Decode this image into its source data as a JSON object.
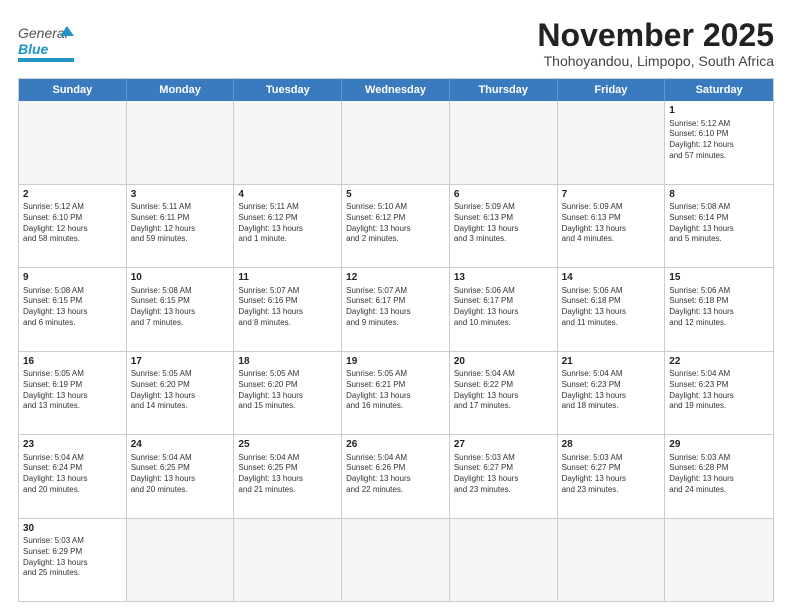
{
  "header": {
    "logo_general": "General",
    "logo_blue": "Blue",
    "title": "November 2025",
    "subtitle": "Thohoyandou, Limpopo, South Africa"
  },
  "days_of_week": [
    "Sunday",
    "Monday",
    "Tuesday",
    "Wednesday",
    "Thursday",
    "Friday",
    "Saturday"
  ],
  "weeks": [
    [
      {
        "date": "",
        "info": ""
      },
      {
        "date": "",
        "info": ""
      },
      {
        "date": "",
        "info": ""
      },
      {
        "date": "",
        "info": ""
      },
      {
        "date": "",
        "info": ""
      },
      {
        "date": "",
        "info": ""
      },
      {
        "date": "1",
        "info": "Sunrise: 5:12 AM\nSunset: 6:10 PM\nDaylight: 12 hours\nand 57 minutes."
      }
    ],
    [
      {
        "date": "2",
        "info": "Sunrise: 5:12 AM\nSunset: 6:10 PM\nDaylight: 12 hours\nand 58 minutes."
      },
      {
        "date": "3",
        "info": "Sunrise: 5:11 AM\nSunset: 6:11 PM\nDaylight: 12 hours\nand 59 minutes."
      },
      {
        "date": "4",
        "info": "Sunrise: 5:11 AM\nSunset: 6:12 PM\nDaylight: 13 hours\nand 1 minute."
      },
      {
        "date": "5",
        "info": "Sunrise: 5:10 AM\nSunset: 6:12 PM\nDaylight: 13 hours\nand 2 minutes."
      },
      {
        "date": "6",
        "info": "Sunrise: 5:09 AM\nSunset: 6:13 PM\nDaylight: 13 hours\nand 3 minutes."
      },
      {
        "date": "7",
        "info": "Sunrise: 5:09 AM\nSunset: 6:13 PM\nDaylight: 13 hours\nand 4 minutes."
      },
      {
        "date": "8",
        "info": "Sunrise: 5:08 AM\nSunset: 6:14 PM\nDaylight: 13 hours\nand 5 minutes."
      }
    ],
    [
      {
        "date": "9",
        "info": "Sunrise: 5:08 AM\nSunset: 6:15 PM\nDaylight: 13 hours\nand 6 minutes."
      },
      {
        "date": "10",
        "info": "Sunrise: 5:08 AM\nSunset: 6:15 PM\nDaylight: 13 hours\nand 7 minutes."
      },
      {
        "date": "11",
        "info": "Sunrise: 5:07 AM\nSunset: 6:16 PM\nDaylight: 13 hours\nand 8 minutes."
      },
      {
        "date": "12",
        "info": "Sunrise: 5:07 AM\nSunset: 6:17 PM\nDaylight: 13 hours\nand 9 minutes."
      },
      {
        "date": "13",
        "info": "Sunrise: 5:06 AM\nSunset: 6:17 PM\nDaylight: 13 hours\nand 10 minutes."
      },
      {
        "date": "14",
        "info": "Sunrise: 5:06 AM\nSunset: 6:18 PM\nDaylight: 13 hours\nand 11 minutes."
      },
      {
        "date": "15",
        "info": "Sunrise: 5:06 AM\nSunset: 6:18 PM\nDaylight: 13 hours\nand 12 minutes."
      }
    ],
    [
      {
        "date": "16",
        "info": "Sunrise: 5:05 AM\nSunset: 6:19 PM\nDaylight: 13 hours\nand 13 minutes."
      },
      {
        "date": "17",
        "info": "Sunrise: 5:05 AM\nSunset: 6:20 PM\nDaylight: 13 hours\nand 14 minutes."
      },
      {
        "date": "18",
        "info": "Sunrise: 5:05 AM\nSunset: 6:20 PM\nDaylight: 13 hours\nand 15 minutes."
      },
      {
        "date": "19",
        "info": "Sunrise: 5:05 AM\nSunset: 6:21 PM\nDaylight: 13 hours\nand 16 minutes."
      },
      {
        "date": "20",
        "info": "Sunrise: 5:04 AM\nSunset: 6:22 PM\nDaylight: 13 hours\nand 17 minutes."
      },
      {
        "date": "21",
        "info": "Sunrise: 5:04 AM\nSunset: 6:23 PM\nDaylight: 13 hours\nand 18 minutes."
      },
      {
        "date": "22",
        "info": "Sunrise: 5:04 AM\nSunset: 6:23 PM\nDaylight: 13 hours\nand 19 minutes."
      }
    ],
    [
      {
        "date": "23",
        "info": "Sunrise: 5:04 AM\nSunset: 6:24 PM\nDaylight: 13 hours\nand 20 minutes."
      },
      {
        "date": "24",
        "info": "Sunrise: 5:04 AM\nSunset: 6:25 PM\nDaylight: 13 hours\nand 20 minutes."
      },
      {
        "date": "25",
        "info": "Sunrise: 5:04 AM\nSunset: 6:25 PM\nDaylight: 13 hours\nand 21 minutes."
      },
      {
        "date": "26",
        "info": "Sunrise: 5:04 AM\nSunset: 6:26 PM\nDaylight: 13 hours\nand 22 minutes."
      },
      {
        "date": "27",
        "info": "Sunrise: 5:03 AM\nSunset: 6:27 PM\nDaylight: 13 hours\nand 23 minutes."
      },
      {
        "date": "28",
        "info": "Sunrise: 5:03 AM\nSunset: 6:27 PM\nDaylight: 13 hours\nand 23 minutes."
      },
      {
        "date": "29",
        "info": "Sunrise: 5:03 AM\nSunset: 6:28 PM\nDaylight: 13 hours\nand 24 minutes."
      }
    ],
    [
      {
        "date": "30",
        "info": "Sunrise: 5:03 AM\nSunset: 6:29 PM\nDaylight: 13 hours\nand 25 minutes."
      },
      {
        "date": "",
        "info": ""
      },
      {
        "date": "",
        "info": ""
      },
      {
        "date": "",
        "info": ""
      },
      {
        "date": "",
        "info": ""
      },
      {
        "date": "",
        "info": ""
      },
      {
        "date": "",
        "info": ""
      }
    ]
  ]
}
